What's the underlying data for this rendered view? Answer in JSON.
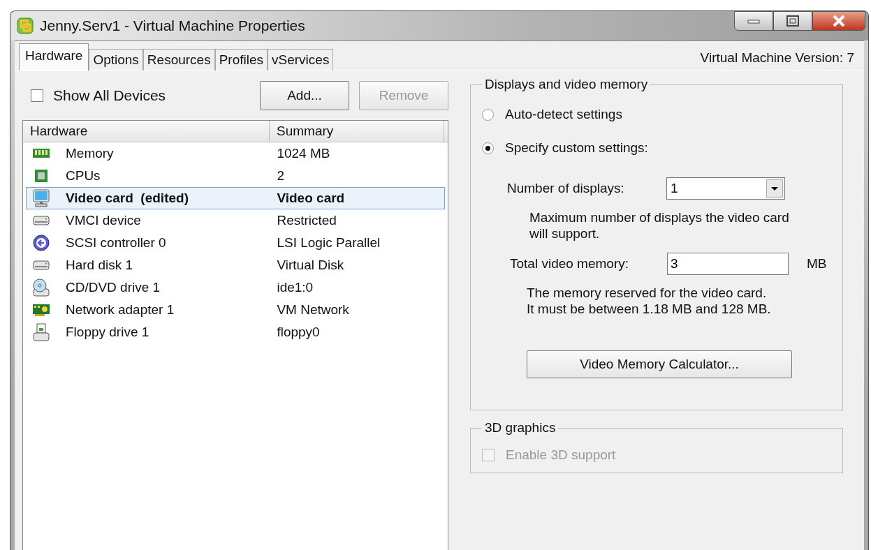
{
  "window": {
    "title": "Jenny.Serv1 - Virtual Machine Properties"
  },
  "tabs": [
    {
      "label": "Hardware",
      "selected": true
    },
    {
      "label": "Options",
      "selected": false
    },
    {
      "label": "Resources",
      "selected": false
    },
    {
      "label": "Profiles",
      "selected": false
    },
    {
      "label": "vServices",
      "selected": false
    }
  ],
  "version": "Virtual Machine Version: 7",
  "show_all_devices": {
    "label": "Show All Devices",
    "checked": false
  },
  "buttons": [
    {
      "label": "Add...",
      "disabled": false
    },
    {
      "label": "Remove",
      "disabled": true
    }
  ],
  "table": {
    "columns": [
      "Hardware",
      "Summary"
    ],
    "rows": [
      {
        "kind": "memory",
        "name": "Memory",
        "summary": "1024 MB",
        "selected": false,
        "edited": false
      },
      {
        "kind": "cpu",
        "name": "CPUs",
        "summary": "2",
        "selected": false,
        "edited": false
      },
      {
        "kind": "monitor",
        "name": "Video card  (edited)",
        "summary": "Video card",
        "selected": true,
        "edited": true
      },
      {
        "kind": "drive",
        "name": "VMCI device",
        "summary": "Restricted",
        "selected": false,
        "edited": false
      },
      {
        "kind": "scsi",
        "name": "SCSI controller 0",
        "summary": "LSI Logic Parallel",
        "selected": false,
        "edited": false
      },
      {
        "kind": "drive",
        "name": "Hard disk 1",
        "summary": "Virtual Disk",
        "selected": false,
        "edited": false
      },
      {
        "kind": "cdrom",
        "name": "CD/DVD drive 1",
        "summary": "ide1:0",
        "selected": false,
        "edited": false
      },
      {
        "kind": "network",
        "name": "Network adapter 1",
        "summary": "VM Network",
        "selected": false,
        "edited": false
      },
      {
        "kind": "floppy",
        "name": "Floppy drive 1",
        "summary": "floppy0",
        "selected": false,
        "edited": false
      }
    ]
  },
  "displays": {
    "title": "Displays and video memory",
    "modes": [
      {
        "label": "Auto-detect settings",
        "selected": false
      },
      {
        "label": "Specify custom settings:",
        "selected": true
      }
    ],
    "number_of_displays": {
      "label": "Number of displays:",
      "value": "1",
      "hint": "Maximum number of displays the video card will support."
    },
    "total_video_memory": {
      "label": "Total video memory:",
      "value": "3",
      "unit": "MB",
      "hint_lines": [
        "The memory reserved for the video card.",
        "It must be between 1.18 MB and 128 MB."
      ]
    },
    "calculator_button": "Video Memory Calculator..."
  },
  "graphics_3d": {
    "title": "3D graphics",
    "enable": {
      "label": "Enable 3D support",
      "checked": false,
      "disabled": true
    }
  }
}
